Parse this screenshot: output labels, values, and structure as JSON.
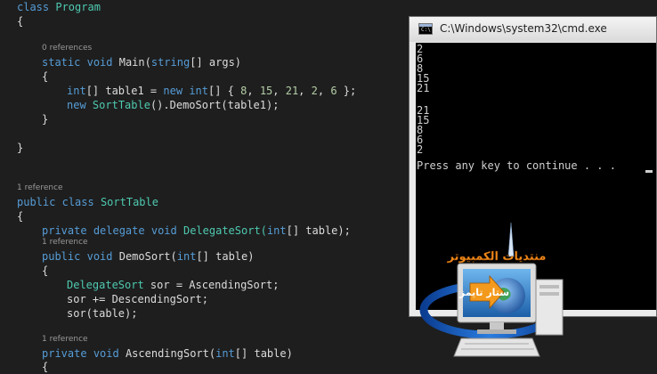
{
  "editor": {
    "code": {
      "class_program_kw": "class",
      "class_program_name": "Program",
      "brace_open": "{",
      "brace_close": "}",
      "main_static": "static",
      "main_void": "void",
      "main_name": "Main(",
      "main_string": "string",
      "main_args": "[] args)",
      "stmt1_int": "int",
      "stmt1_mid": "[] table1 = ",
      "stmt1_new": "new",
      "stmt1_int2": "int",
      "stmt1_arr": "[] { ",
      "n8": "8",
      "n15": "15",
      "n21": "21",
      "n2": "2",
      "n6": "6",
      "sep": ", ",
      "stmt1_end": " };",
      "stmt2_new": "new",
      "stmt2_type": "SortTable",
      "stmt2_rest": "().DemoSort(table1);",
      "class_public": "public",
      "class_kw2": "class",
      "class_sorttable": "SortTable",
      "del_private": "private",
      "del_delegate": "delegate",
      "del_void": "void",
      "del_name": "DelegateSort(",
      "del_int": "int",
      "del_rest": "[] table);",
      "demo_public": "public",
      "demo_void": "void",
      "demo_name": "DemoSort(",
      "demo_int": "int",
      "demo_rest": "[] table)",
      "ds_type": "DelegateSort",
      "ds_rest": " sor = AscendingSort;",
      "ds_line2": "sor += DescendingSort;",
      "ds_line3": "sor(table);",
      "asc_private": "private",
      "asc_void": "void",
      "asc_name": "AscendingSort(",
      "asc_int": "int",
      "asc_rest": "[] table)"
    },
    "codelens": {
      "zero_references": "0 references",
      "one_reference": "1 reference"
    }
  },
  "cmd_window": {
    "title": "C:\\Windows\\system32\\cmd.exe",
    "icon_text": "C:\\",
    "output_lines": [
      "2",
      "6",
      "8",
      "15",
      "21",
      "",
      "21",
      "15",
      "8",
      "6",
      "2"
    ],
    "prompt": "Press any key to continue . . ."
  },
  "logo": {
    "top_text": "منتديات الكمبيوتر",
    "screen_text": "ستار تايمز"
  }
}
